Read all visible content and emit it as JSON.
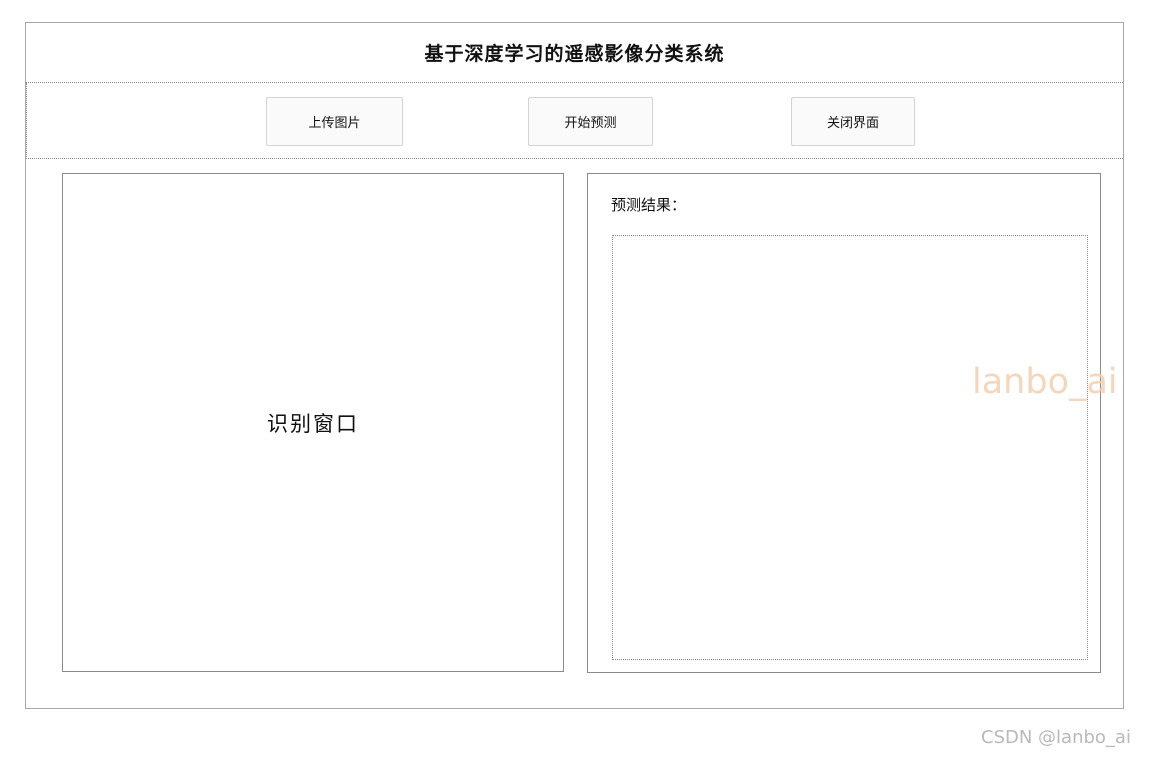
{
  "app": {
    "title": "基于深度学习的遥感影像分类系统"
  },
  "toolbar": {
    "upload_label": "上传图片",
    "predict_label": "开始预测",
    "close_label": "关闭界面"
  },
  "image_panel": {
    "placeholder": "识别窗口"
  },
  "result_panel": {
    "label": "预测结果：",
    "text": ""
  },
  "watermarks": {
    "center": "lanbo_ai",
    "corner": "CSDN @lanbo_ai"
  }
}
